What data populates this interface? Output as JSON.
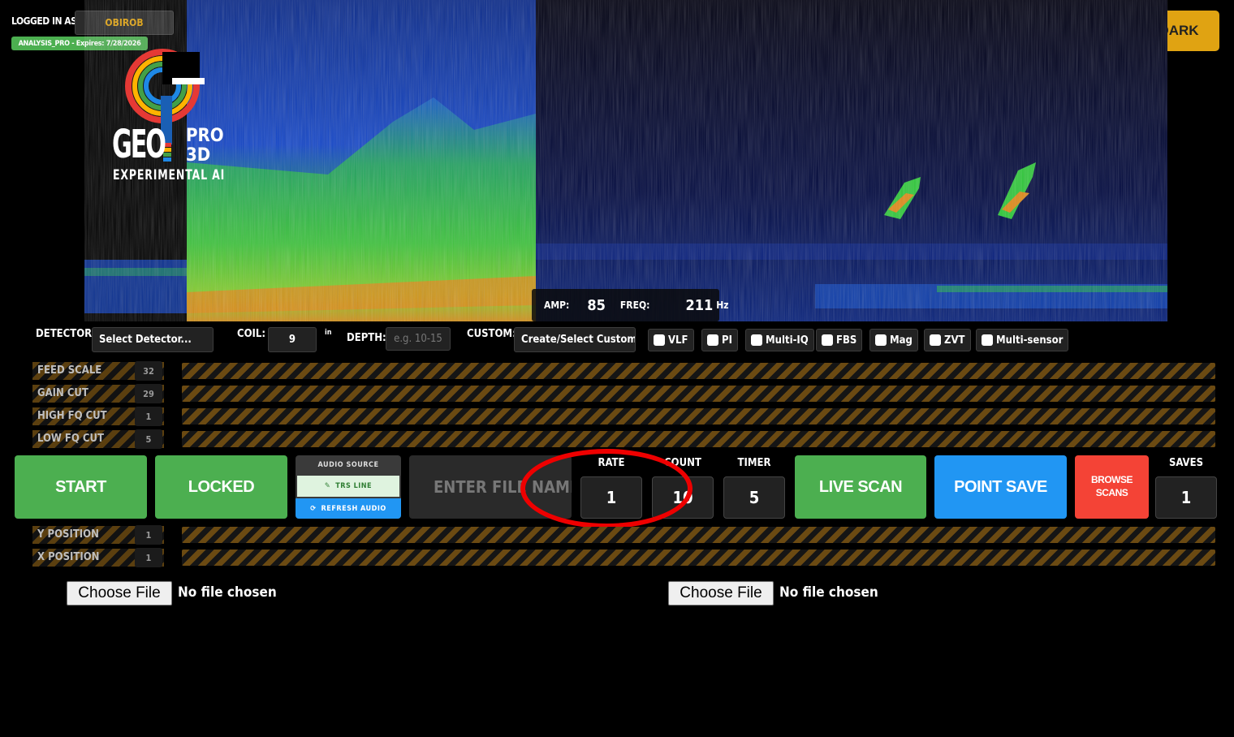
{
  "header": {
    "login_label": "LOGGED IN AS:",
    "username": "OBIROB",
    "plan_badge": "ANALYSIS_PRO - Expires: 7/28/2026",
    "theme_button": "DARK"
  },
  "logo": {
    "word_geo": "GEO",
    "word_pro": "PRO",
    "word_3d": "3D",
    "tagline": "EXPERIMENTAL AI"
  },
  "readout": {
    "amp_label": "AMP:",
    "amp_value": "85",
    "freq_label": "FREQ:",
    "freq_value": "211",
    "freq_unit": "Hz"
  },
  "detector_row": {
    "detector_label": "DETECTOR:",
    "detector_select": "Select Detector...",
    "coil_label": "COIL:",
    "coil_value": "9",
    "coil_unit": "in",
    "depth_label": "DEPTH:",
    "depth_placeholder": "e.g. 10-15",
    "custom_label": "CUSTOM:",
    "custom_select": "Create/Select Custom...",
    "checkboxes": [
      {
        "label": "VLF",
        "checked": false
      },
      {
        "label": "PI",
        "checked": false
      },
      {
        "label": "Multi-IQ",
        "checked": false
      },
      {
        "label": "FBS",
        "checked": false
      },
      {
        "label": "Mag",
        "checked": false
      },
      {
        "label": "ZVT",
        "checked": false
      },
      {
        "label": "Multi-sensor",
        "checked": false
      }
    ]
  },
  "sliders_top": [
    {
      "label": "FEED SCALE",
      "value": "32"
    },
    {
      "label": "GAIN CUT",
      "value": "29"
    },
    {
      "label": "HIGH FQ CUT",
      "value": "1"
    },
    {
      "label": "LOW FQ CUT",
      "value": "5"
    }
  ],
  "controls": {
    "start_button": "START",
    "locked_button": "LOCKED",
    "audio_source_title": "AUDIO SOURCE",
    "audio_line_label": "TRS LINE",
    "refresh_audio_label": "REFRESH AUDIO",
    "filename_placeholder": "ENTER FILE NAME",
    "rate_label": "RATE",
    "rate_value": "1",
    "count_label": "COUNT",
    "count_value": "10",
    "timer_label": "TIMER",
    "timer_value": "5",
    "live_scan_button": "LIVE SCAN",
    "point_save_button": "POINT SAVE",
    "browse_scans_line1": "BROWSE",
    "browse_scans_line2": "SCANS",
    "saves_label": "SAVES",
    "saves_value": "1"
  },
  "sliders_bottom": [
    {
      "label": "Y POSITION",
      "value": "1"
    },
    {
      "label": "X POSITION",
      "value": "1"
    }
  ],
  "file_inputs": [
    {
      "button": "Choose File",
      "status": "No file chosen"
    },
    {
      "button": "Choose File",
      "status": "No file chosen"
    }
  ],
  "colors": {
    "accent_gold": "#e0a312",
    "green": "#4caf50",
    "blue": "#2196f3",
    "red": "#f44336",
    "highlight": "#ee0000"
  }
}
